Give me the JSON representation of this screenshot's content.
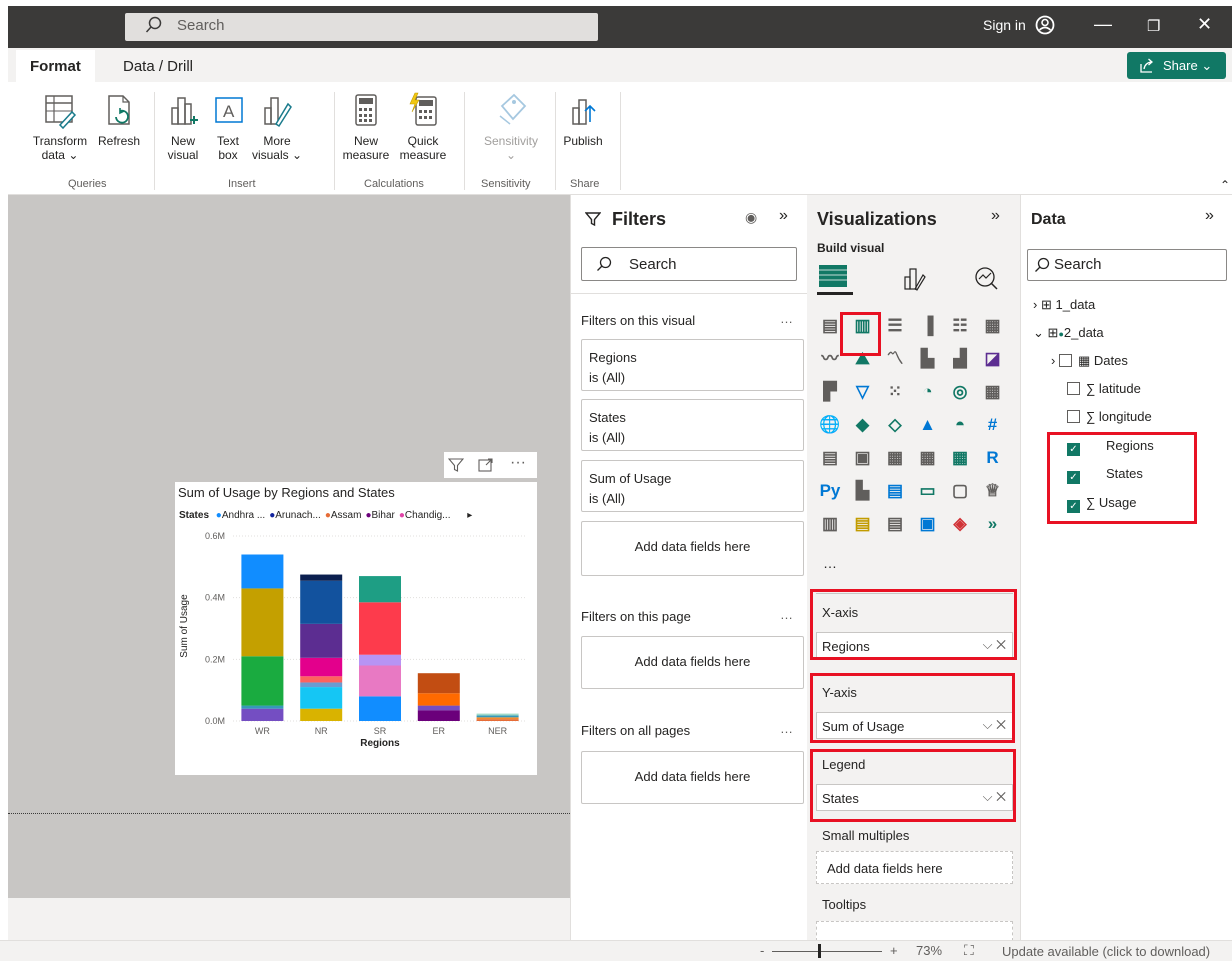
{
  "topbar": {
    "search_placeholder": "Search",
    "signin": "Sign in"
  },
  "tabs": {
    "format": "Format",
    "data_drill": "Data / Drill",
    "share": "Share"
  },
  "ribbon": {
    "transform": "Transform",
    "transform2": "data",
    "refresh": "Refresh",
    "new_visual": "New",
    "new_visual2": "visual",
    "text_box": "Text",
    "text_box2": "box",
    "more_visuals": "More",
    "more_visuals2": "visuals",
    "new_measure": "New",
    "new_measure2": "measure",
    "quick_measure": "Quick",
    "quick_measure2": "measure",
    "sensitivity": "Sensitivity",
    "publish": "Publish",
    "groups": {
      "queries": "Queries",
      "insert": "Insert",
      "calculations": "Calculations",
      "sensitivity": "Sensitivity",
      "share": "Share"
    }
  },
  "visual": {
    "title": "Sum of Usage by Regions and States",
    "legend_title": "States",
    "legend_items": [
      "Andhra ...",
      "Arunach...",
      "Assam",
      "Bihar",
      "Chandig..."
    ],
    "legend_colors": [
      "#118dff",
      "#12239e",
      "#e66c37",
      "#6b007b",
      "#e044a7"
    ]
  },
  "chart_data": {
    "type": "bar",
    "stacked": true,
    "categories": [
      "WR",
      "NR",
      "SR",
      "ER",
      "NER"
    ],
    "xlabel": "Regions",
    "ylabel": "Sum of Usage",
    "yticks": [
      "0.0M",
      "0.2M",
      "0.4M",
      "0.6M"
    ],
    "ylim": [
      0,
      0.6
    ],
    "stacks": [
      [
        {
          "v": 0.04,
          "c": "#744ec2"
        },
        {
          "v": 0.01,
          "c": "#3599b8"
        },
        {
          "v": 0.16,
          "c": "#1aab40"
        },
        {
          "v": 0.22,
          "c": "#c4a000"
        },
        {
          "v": 0.11,
          "c": "#118dff"
        }
      ],
      [
        {
          "v": 0.04,
          "c": "#d9b300"
        },
        {
          "v": 0.07,
          "c": "#15c6f4"
        },
        {
          "v": 0.015,
          "c": "#6b9bd1"
        },
        {
          "v": 0.02,
          "c": "#fd625e"
        },
        {
          "v": 0.06,
          "c": "#e3008c"
        },
        {
          "v": 0.11,
          "c": "#5c2d91"
        },
        {
          "v": 0.14,
          "c": "#12529e"
        },
        {
          "v": 0.02,
          "c": "#0b1f4f"
        }
      ],
      [
        {
          "v": 0.08,
          "c": "#118dff"
        },
        {
          "v": 0.1,
          "c": "#e879c3"
        },
        {
          "v": 0.035,
          "c": "#b794f4"
        },
        {
          "v": 0.17,
          "c": "#fd3b4c"
        },
        {
          "v": 0.085,
          "c": "#1e9e84"
        }
      ],
      [
        {
          "v": 0.035,
          "c": "#6b007b"
        },
        {
          "v": 0.015,
          "c": "#744ec2"
        },
        {
          "v": 0.04,
          "c": "#ff6a00"
        },
        {
          "v": 0.065,
          "c": "#c24d12"
        }
      ],
      [
        {
          "v": 0.006,
          "c": "#e66c37"
        },
        {
          "v": 0.006,
          "c": "#f28b2c"
        },
        {
          "v": 0.006,
          "c": "#3599b8"
        },
        {
          "v": 0.006,
          "c": "#9fd9c9"
        }
      ]
    ]
  },
  "filters": {
    "title": "Filters",
    "search": "Search",
    "on_visual": "Filters on this visual",
    "cards": [
      {
        "name": "Regions",
        "val": "is (All)"
      },
      {
        "name": "States",
        "val": "is (All)"
      },
      {
        "name": "Sum of Usage",
        "val": "is (All)"
      }
    ],
    "add": "Add data fields here",
    "on_page": "Filters on this page",
    "on_all": "Filters on all pages"
  },
  "viz": {
    "title": "Visualizations",
    "build": "Build visual",
    "xaxis": "X-axis",
    "xfield": "Regions",
    "yaxis": "Y-axis",
    "yfield": "Sum of Usage",
    "legend": "Legend",
    "legendfield": "States",
    "small": "Small multiples",
    "add": "Add data fields here",
    "tooltips": "Tooltips"
  },
  "data": {
    "title": "Data",
    "search": "Search",
    "tables": [
      "1_data",
      "2_data"
    ],
    "fields": [
      "Dates",
      "latitude",
      "longitude",
      "Regions",
      "States",
      "Usage"
    ]
  },
  "status": {
    "zoom": "73%",
    "update": "Update available (click to download)"
  }
}
